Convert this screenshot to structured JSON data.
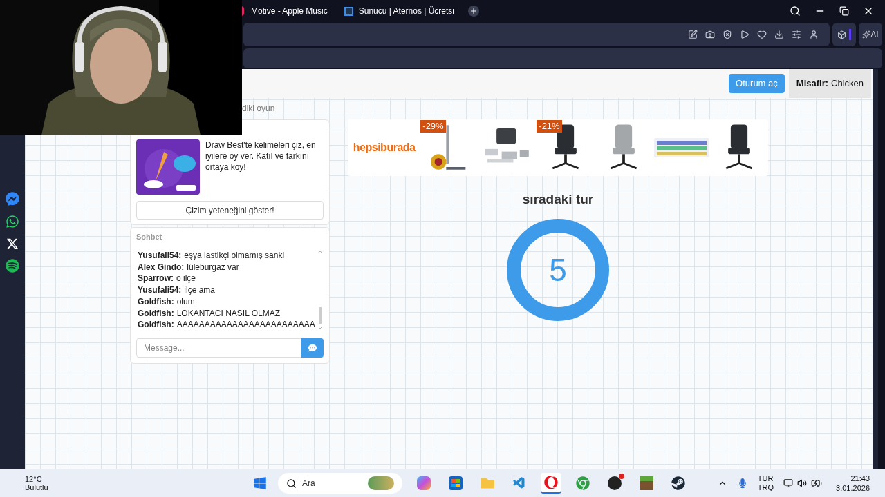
{
  "browser": {
    "tabs": [
      {
        "label": "Motive - Apple Music",
        "selected": false
      },
      {
        "label": "Sunucu | Aternos | Ücretsi",
        "selected": false
      }
    ],
    "ai_button": "AI"
  },
  "header": {
    "login_button": "Oturum aç",
    "guest_label": "Misafir:",
    "guest_name": "Chicken"
  },
  "previous_game_text": "diki oyun",
  "promo": {
    "text": "Draw Best'te kelimeleri çiz, en iyilere oy ver. Katıl ve farkını ortaya koy!",
    "button": "Çizim yeteneğini göster!"
  },
  "chat": {
    "title": "Sohbet",
    "messages": [
      {
        "name": "Yusufali54:",
        "text": "eşya lastikçi olmamış sanki"
      },
      {
        "name": "Alex Gindo:",
        "text": "lüleburgaz var"
      },
      {
        "name": "Sparrow:",
        "text": "o ilçe"
      },
      {
        "name": "Yusufali54:",
        "text": "ilçe ama"
      },
      {
        "name": "Goldfish:",
        "text": "olum"
      },
      {
        "name": "Goldfish:",
        "text": "LOKANTACI NASIL OLMAZ"
      },
      {
        "name": "Goldfish:",
        "text": "AAAAAAAAAAAAAAAAAAAAAAAAA"
      }
    ],
    "input": {
      "placeholder": "Message..."
    }
  },
  "ad": {
    "brand": "hepsiburada",
    "products": [
      {
        "kind": "vacuum",
        "discount": "-29%"
      },
      {
        "kind": "drone"
      },
      {
        "kind": "chair",
        "discount": "-21%"
      },
      {
        "kind": "chair_light"
      },
      {
        "kind": "keyboard"
      },
      {
        "kind": "chair"
      }
    ]
  },
  "round": {
    "title": "sıradaki tur",
    "countdown": "5"
  },
  "taskbar": {
    "weather": {
      "temp": "12°C",
      "condition": "Bulutlu"
    },
    "search_placeholder": "Ara",
    "language": [
      "TUR",
      "TRQ"
    ],
    "time": "21:43",
    "date": "3.01.2026"
  }
}
